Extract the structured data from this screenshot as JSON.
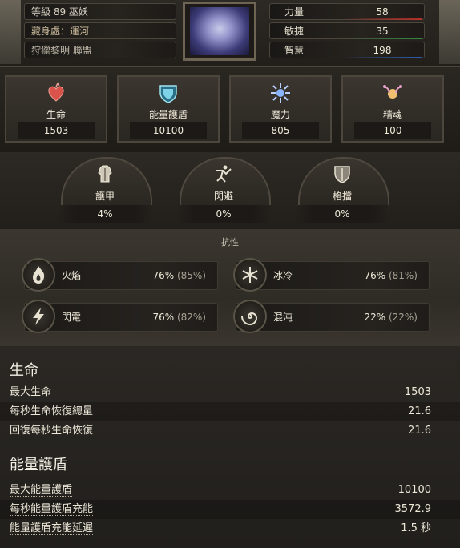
{
  "header": {
    "left_rows": [
      {
        "text": "等級 89 巫妖"
      },
      {
        "text": "藏身處：運河"
      },
      {
        "text": "狩獵黎明 聯盟"
      }
    ],
    "attributes": [
      {
        "label": "力量",
        "value": "58",
        "color": "#b8322b"
      },
      {
        "label": "敏捷",
        "value": "35",
        "color": "#2f8a3d"
      },
      {
        "label": "智慧",
        "value": "198",
        "color": "#2f5fb3"
      }
    ]
  },
  "core": [
    {
      "icon": "heart-icon",
      "label": "生命",
      "value": "1503",
      "color": "#d9534a"
    },
    {
      "icon": "energy-shield-icon",
      "label": "能量護盾",
      "value": "10100",
      "color": "#7fd3e8"
    },
    {
      "icon": "mana-icon",
      "label": "魔力",
      "value": "805",
      "color": "#8ab4ff"
    },
    {
      "icon": "spirit-icon",
      "label": "精魂",
      "value": "100",
      "color": "#f0c070"
    }
  ],
  "defense": [
    {
      "icon": "armour-icon",
      "label": "護甲",
      "value": "4%"
    },
    {
      "icon": "evasion-icon",
      "label": "閃避",
      "value": "0%"
    },
    {
      "icon": "block-icon",
      "label": "格擋",
      "value": "0%"
    }
  ],
  "resist": {
    "title": "抗性",
    "items": [
      {
        "icon": "fire-icon",
        "label": "火焰",
        "value": "76%",
        "cap": "(85%)"
      },
      {
        "icon": "cold-icon",
        "label": "冰冷",
        "value": "76%",
        "cap": "(81%)"
      },
      {
        "icon": "lightning-icon",
        "label": "閃電",
        "value": "76%",
        "cap": "(82%)"
      },
      {
        "icon": "chaos-icon",
        "label": "混沌",
        "value": "22%",
        "cap": "(22%)"
      }
    ]
  },
  "sections": [
    {
      "title": "生命",
      "rows": [
        {
          "label": "最大生命",
          "value": "1503"
        },
        {
          "label": "每秒生命恢復總量",
          "value": "21.6"
        },
        {
          "label": "回復每秒生命恢復",
          "value": "21.6"
        }
      ]
    },
    {
      "title": "能量護盾",
      "rows": [
        {
          "label": "最大能量護盾",
          "value": "10100"
        },
        {
          "label": "每秒能量護盾充能",
          "value": "3572.9"
        },
        {
          "label": "能量護盾充能延遲",
          "value": "1.5 秒"
        }
      ]
    }
  ]
}
